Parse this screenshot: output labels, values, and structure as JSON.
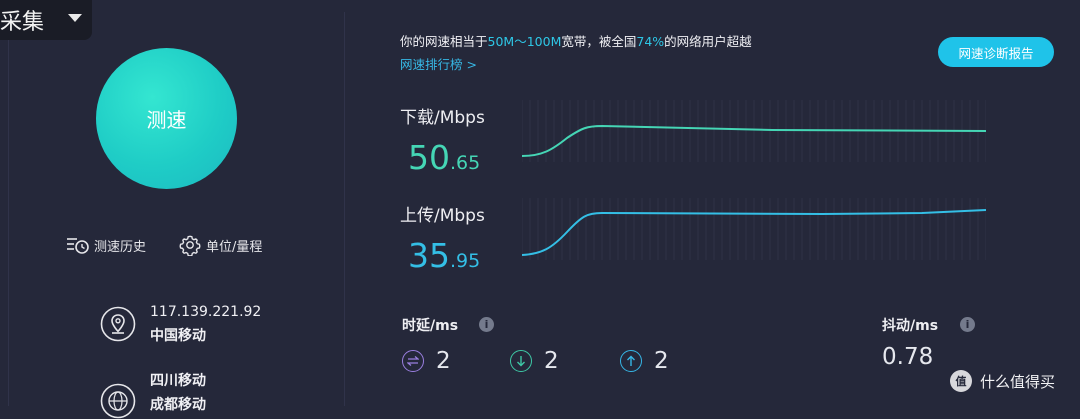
{
  "window": {
    "menu_label": "采集"
  },
  "left": {
    "speed_button": "测速",
    "tools": {
      "history": "测速历史",
      "unit": "单位/量程"
    },
    "ip": {
      "address": "117.139.221.92",
      "isp": "中国移动"
    },
    "server": {
      "line1": "四川移动",
      "line2": "成都移动"
    }
  },
  "summary": {
    "prefix": "你的网速相当于",
    "bandwidth": "50M～100M",
    "middle": "宽带，被全国",
    "percent": "74%",
    "suffix": "的网络用户超越",
    "rank_link": "网速排行榜 >"
  },
  "diagnose_button": "网速诊断报告",
  "download": {
    "label": "下载/Mbps",
    "int": "50",
    "frac": ".65",
    "color": "#45d6b5"
  },
  "upload": {
    "label": "上传/Mbps",
    "int": "35",
    "frac": ".95",
    "color": "#34bfe6"
  },
  "latency": {
    "label": "时延/ms",
    "values": [
      {
        "icon": "swap-arrows-icon",
        "value": "2",
        "color": "#9a7fe0"
      },
      {
        "icon": "arrow-down-icon",
        "value": "2",
        "color": "#3ec9a6"
      },
      {
        "icon": "arrow-up-icon",
        "value": "2",
        "color": "#36b6e6"
      }
    ]
  },
  "jitter": {
    "label": "抖动/ms",
    "value": "0.78"
  },
  "watermark": {
    "logo": "值",
    "text": "什么值得买"
  }
}
